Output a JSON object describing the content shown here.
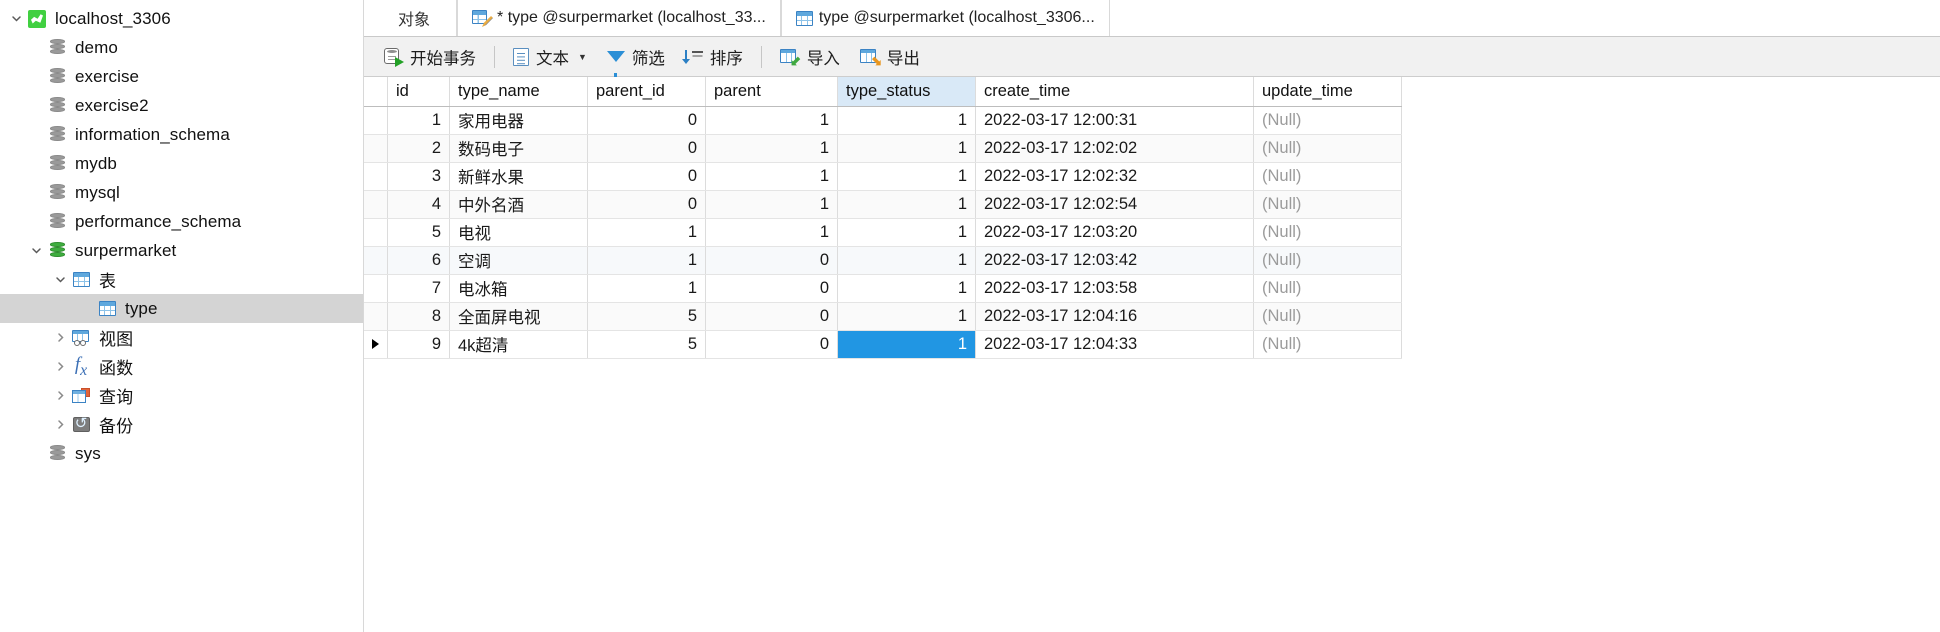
{
  "sidebar": {
    "items": [
      {
        "label": "localhost_3306",
        "icon": "mysql-connection-icon",
        "depth": 0,
        "twisty": "expanded",
        "selected": false
      },
      {
        "label": "demo",
        "icon": "database-icon",
        "depth": 1,
        "twisty": "none",
        "selected": false
      },
      {
        "label": "exercise",
        "icon": "database-icon",
        "depth": 1,
        "twisty": "none",
        "selected": false
      },
      {
        "label": "exercise2",
        "icon": "database-icon",
        "depth": 1,
        "twisty": "none",
        "selected": false
      },
      {
        "label": "information_schema",
        "icon": "database-icon",
        "depth": 1,
        "twisty": "none",
        "selected": false
      },
      {
        "label": "mydb",
        "icon": "database-icon",
        "depth": 1,
        "twisty": "none",
        "selected": false
      },
      {
        "label": "mysql",
        "icon": "database-icon",
        "depth": 1,
        "twisty": "none",
        "selected": false
      },
      {
        "label": "performance_schema",
        "icon": "database-icon",
        "depth": 1,
        "twisty": "none",
        "selected": false
      },
      {
        "label": "surpermarket",
        "icon": "database-open-icon",
        "depth": 1,
        "twisty": "expanded",
        "selected": false
      },
      {
        "label": "表",
        "icon": "tables-folder-icon",
        "depth": 2,
        "twisty": "expanded",
        "selected": false
      },
      {
        "label": "type",
        "icon": "table-icon",
        "depth": 3,
        "twisty": "none",
        "selected": true
      },
      {
        "label": "视图",
        "icon": "views-folder-icon",
        "depth": 2,
        "twisty": "collapsed",
        "selected": false
      },
      {
        "label": "函数",
        "icon": "functions-folder-icon",
        "depth": 2,
        "twisty": "collapsed",
        "selected": false
      },
      {
        "label": "查询",
        "icon": "queries-folder-icon",
        "depth": 2,
        "twisty": "collapsed",
        "selected": false
      },
      {
        "label": "备份",
        "icon": "backups-folder-icon",
        "depth": 2,
        "twisty": "collapsed",
        "selected": false
      },
      {
        "label": "sys",
        "icon": "database-icon",
        "depth": 1,
        "twisty": "none",
        "selected": false
      }
    ]
  },
  "tabs": [
    {
      "label": "对象",
      "icon": "none",
      "active": false
    },
    {
      "label": "* type @surpermarket (localhost_33...",
      "icon": "table-design-icon",
      "active": false
    },
    {
      "label": "type @surpermarket (localhost_3306...",
      "icon": "table-icon",
      "active": true
    }
  ],
  "toolbar": {
    "begin_transaction": "开始事务",
    "text": "文本",
    "filter": "筛选",
    "sort": "排序",
    "import": "导入",
    "export": "导出"
  },
  "grid": {
    "columns": [
      "id",
      "type_name",
      "parent_id",
      "parent",
      "type_status",
      "create_time",
      "update_time"
    ],
    "highlighted_column": "type_status",
    "null_text": "(Null)",
    "selected_cell": {
      "row": 9,
      "column": "type_status"
    },
    "current_row_marker": 9,
    "rows": [
      {
        "id": "1",
        "type_name": "家用电器",
        "parent_id": "0",
        "parent": "1",
        "type_status": "1",
        "create_time": "2022-03-17 12:00:31",
        "update_time": "(Null)"
      },
      {
        "id": "2",
        "type_name": "数码电子",
        "parent_id": "0",
        "parent": "1",
        "type_status": "1",
        "create_time": "2022-03-17 12:02:02",
        "update_time": "(Null)"
      },
      {
        "id": "3",
        "type_name": "新鲜水果",
        "parent_id": "0",
        "parent": "1",
        "type_status": "1",
        "create_time": "2022-03-17 12:02:32",
        "update_time": "(Null)"
      },
      {
        "id": "4",
        "type_name": "中外名酒",
        "parent_id": "0",
        "parent": "1",
        "type_status": "1",
        "create_time": "2022-03-17 12:02:54",
        "update_time": "(Null)"
      },
      {
        "id": "5",
        "type_name": "电视",
        "parent_id": "1",
        "parent": "1",
        "type_status": "1",
        "create_time": "2022-03-17 12:03:20",
        "update_time": "(Null)"
      },
      {
        "id": "6",
        "type_name": "空调",
        "parent_id": "1",
        "parent": "0",
        "type_status": "1",
        "create_time": "2022-03-17 12:03:42",
        "update_time": "(Null)"
      },
      {
        "id": "7",
        "type_name": "电冰箱",
        "parent_id": "1",
        "parent": "0",
        "type_status": "1",
        "create_time": "2022-03-17 12:03:58",
        "update_time": "(Null)"
      },
      {
        "id": "8",
        "type_name": "全面屏电视",
        "parent_id": "5",
        "parent": "0",
        "type_status": "1",
        "create_time": "2022-03-17 12:04:16",
        "update_time": "(Null)"
      },
      {
        "id": "9",
        "type_name": "4k超清",
        "parent_id": "5",
        "parent": "0",
        "type_status": "1",
        "create_time": "2022-03-17 12:04:33",
        "update_time": "(Null)"
      }
    ]
  },
  "colors": {
    "selection_blue": "#2196e3",
    "header_highlight": "#d9e9f7",
    "tree_selection": "#d4d4d4",
    "null_text": "#9b9b9b"
  }
}
